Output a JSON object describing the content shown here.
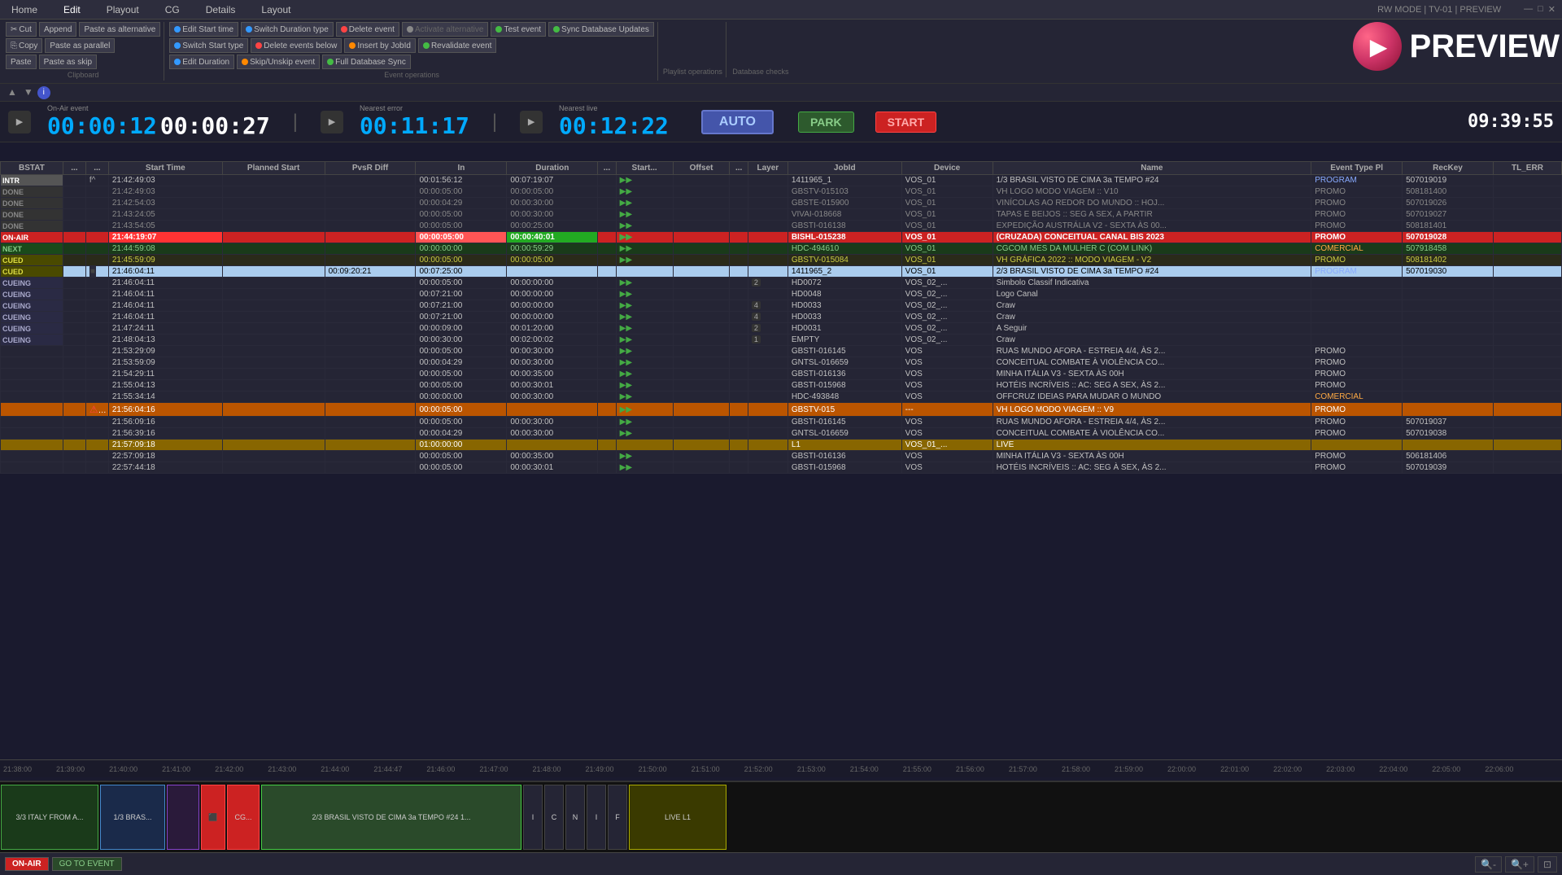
{
  "app": {
    "mode": "RW MODE | TV-01 | PREVIEW",
    "title": "PREVIEW"
  },
  "menu": {
    "items": [
      "Home",
      "Edit",
      "Playout",
      "CG",
      "Details",
      "Layout"
    ],
    "active": "Edit"
  },
  "clipboard": {
    "label": "Clipboard",
    "cut": "Cut",
    "append": "Append",
    "paste_alt": "Paste as alternative",
    "copy": "Copy",
    "paste_parallel": "Paste as parallel",
    "paste": "Paste",
    "paste_skip": "Paste as skip"
  },
  "event_ops": {
    "label": "Event operations",
    "edit_start": "Edit Start time",
    "switch_duration": "Switch Duration type",
    "switch_start": "Switch Start type",
    "delete_event": "Delete event",
    "activate_alt": "Activate alternative",
    "test_event": "Test event",
    "sync_db": "Sync Database Updates",
    "edit_duration": "Edit Duration",
    "delete_below": "Delete events below",
    "insert_jobid": "Insert by JobId",
    "revalidate": "Revalidate event",
    "skip_unskip": "Skip/Unskip event",
    "full_sync": "Full Database Sync"
  },
  "timecodes": {
    "onair_label": "On-Air event",
    "onair_elapsed": "00:00:12",
    "onair_remaining": "00:00:27",
    "error_label": "Nearest error",
    "error_value": "00:11:17",
    "live_label": "Nearest live",
    "live_value": "00:12:22",
    "auto": "AUTO",
    "park": "PARK",
    "start": "START",
    "clock": "09:39:55"
  },
  "table": {
    "columns": [
      "BSTAT",
      "...",
      "...",
      "Start Time",
      "Planned Start",
      "PvsR Diff",
      "In",
      "Duration",
      "...",
      "Start...",
      "Offset",
      "...",
      "Layer",
      "JobId",
      "Device",
      "Name",
      "Event Type Pl",
      "RecKey",
      "TL_ERR"
    ],
    "rows": [
      {
        "bstat": "INTR",
        "bstat_class": "intr",
        "row_class": "intr",
        "f": "f^",
        "start": "21:42:49:03",
        "planned": "",
        "pvsr": "",
        "in": "00:01:56:12",
        "duration": "00:07:19:07",
        "start2": "▶▶",
        "offset": "",
        "layer": "",
        "jobid": "1411965_1",
        "device": "VOS_01",
        "name": "1/3 BRASIL VISTO DE CIMA 3a TEMPO #24",
        "evtype": "PROGRAM",
        "reckey": "507019019",
        "tlerr": ""
      },
      {
        "bstat": "DONE",
        "bstat_class": "done",
        "row_class": "done",
        "f": "",
        "start": "21:42:49:03",
        "planned": "",
        "pvsr": "",
        "in": "00:00:05:00",
        "duration": "00:00:05:00",
        "start2": "▶▶",
        "offset": "",
        "layer": "",
        "jobid": "GBSTV-015103",
        "device": "VOS_01",
        "name": "VH LOGO MODO VIAGEM :: V10",
        "evtype": "PROMO",
        "reckey": "508181400",
        "tlerr": ""
      },
      {
        "bstat": "DONE",
        "bstat_class": "done",
        "row_class": "done",
        "f": "",
        "start": "21:42:54:03",
        "planned": "",
        "pvsr": "",
        "in": "00:00:04:29",
        "duration": "00:00:30:00",
        "start2": "▶▶",
        "offset": "",
        "layer": "",
        "jobid": "GBSTE-015900",
        "device": "VOS_01",
        "name": "VINÍCOLAS AO REDOR DO MUNDO :: HOJ...",
        "evtype": "PROMO",
        "reckey": "507019026",
        "tlerr": ""
      },
      {
        "bstat": "DONE",
        "bstat_class": "done",
        "row_class": "done",
        "f": "",
        "start": "21:43:24:05",
        "planned": "",
        "pvsr": "",
        "in": "00:00:05:00",
        "duration": "00:00:30:00",
        "start2": "▶▶",
        "offset": "",
        "layer": "",
        "jobid": "VIVAI-018668",
        "device": "VOS_01",
        "name": "TAPAS E BEIJOS :: SEG A SEX, A PARTIR",
        "evtype": "PROMO",
        "reckey": "507019027",
        "tlerr": ""
      },
      {
        "bstat": "DONE",
        "bstat_class": "done",
        "row_class": "done",
        "f": "",
        "start": "21:43:54:05",
        "planned": "",
        "pvsr": "",
        "in": "00:00:05:00",
        "duration": "00:00:25:00",
        "start2": "▶▶",
        "offset": "",
        "layer": "",
        "jobid": "GBSTI-016138",
        "device": "VOS_01",
        "name": "EXPEDIÇÃO AUSTRÁLIA V2 - SEXTA ÀS 00...",
        "evtype": "PROMO",
        "reckey": "508181401",
        "tlerr": ""
      },
      {
        "bstat": "ON-AIR",
        "bstat_class": "onair",
        "row_class": "onair",
        "f": "",
        "start": "21:44:19:07",
        "planned": "",
        "pvsr": "",
        "in": "00:00:05:00",
        "duration": "00:00:40:01",
        "start2": "▶▶",
        "offset": "",
        "layer": "",
        "jobid": "BISHL-015238",
        "device": "VOS_01",
        "name": "(CRUZADA) CONCEITUAL CANAL BIS 2023",
        "evtype": "PROMO",
        "reckey": "507019028",
        "tlerr": ""
      },
      {
        "bstat": "NEXT",
        "bstat_class": "next",
        "row_class": "next",
        "f": "",
        "start": "21:44:59:08",
        "planned": "",
        "pvsr": "",
        "in": "00:00:00:00",
        "duration": "00:00:59:29",
        "start2": "▶▶",
        "offset": "",
        "layer": "",
        "jobid": "HDC-494610",
        "device": "VOS_01",
        "name": "CGCOM MES DA MULHER C (COM LINK)",
        "evtype": "COMERCIAL",
        "reckey": "507918458",
        "tlerr": ""
      },
      {
        "bstat": "CUED",
        "bstat_class": "cued",
        "row_class": "cued",
        "f": "",
        "start": "21:45:59:09",
        "planned": "",
        "pvsr": "",
        "in": "00:00:05:00",
        "duration": "00:00:05:00",
        "start2": "▶▶",
        "offset": "",
        "layer": "",
        "jobid": "GBSTV-015084",
        "device": "VOS_01",
        "name": "VH GRÁFICA 2022 :: MODO VIAGEM - V2",
        "evtype": "PROMO",
        "reckey": "508181402",
        "tlerr": ""
      },
      {
        "bstat": "CUED",
        "bstat_class": "cued",
        "row_class": "light",
        "f": "■",
        "start": "21:46:04:11",
        "planned": "",
        "pvsr": "00:09:20:21",
        "in": "00:07:25:00",
        "duration": "",
        "start2": "",
        "offset": "",
        "layer": "",
        "jobid": "1411965_2",
        "device": "VOS_01",
        "name": "2/3 BRASIL VISTO DE CIMA 3a TEMPO #24",
        "evtype": "PROGRAM",
        "reckey": "507019030",
        "tlerr": ""
      },
      {
        "bstat": "CUEING",
        "bstat_class": "cueing",
        "row_class": "default",
        "f": "",
        "start": "21:46:04:11",
        "planned": "",
        "pvsr": "",
        "in": "00:00:05:00",
        "duration": "00:00:00:00",
        "start2": "▶▶",
        "offset": "",
        "layer": "2",
        "jobid": "HD0072",
        "device": "VOS_02_...",
        "name": "Simbolo Classif Indicativa",
        "evtype": "",
        "reckey": "",
        "tlerr": ""
      },
      {
        "bstat": "CUEING",
        "bstat_class": "cueing",
        "row_class": "default",
        "f": "",
        "start": "21:46:04:11",
        "planned": "",
        "pvsr": "",
        "in": "00:07:21:00",
        "duration": "00:00:00:00",
        "start2": "▶▶",
        "offset": "",
        "layer": "",
        "jobid": "HD0048",
        "device": "VOS_02_...",
        "name": "Logo Canal",
        "evtype": "",
        "reckey": "",
        "tlerr": ""
      },
      {
        "bstat": "CUEING",
        "bstat_class": "cueing",
        "row_class": "default",
        "f": "",
        "start": "21:46:04:11",
        "planned": "",
        "pvsr": "",
        "in": "00:07:21:00",
        "duration": "00:00:00:00",
        "start2": "▶▶",
        "offset": "",
        "layer": "4",
        "jobid": "HD0033",
        "device": "VOS_02_...",
        "name": "Craw",
        "evtype": "",
        "reckey": "",
        "tlerr": ""
      },
      {
        "bstat": "CUEING",
        "bstat_class": "cueing",
        "row_class": "default",
        "f": "",
        "start": "21:46:04:11",
        "planned": "",
        "pvsr": "",
        "in": "00:07:21:00",
        "duration": "00:00:00:00",
        "start2": "▶▶",
        "offset": "",
        "layer": "4",
        "jobid": "HD0033",
        "device": "VOS_02_...",
        "name": "Craw",
        "evtype": "",
        "reckey": "",
        "tlerr": ""
      },
      {
        "bstat": "CUEING",
        "bstat_class": "cueing",
        "row_class": "default",
        "f": "",
        "start": "21:47:24:11",
        "planned": "",
        "pvsr": "",
        "in": "00:00:09:00",
        "duration": "00:01:20:00",
        "start2": "▶▶",
        "offset": "",
        "layer": "2",
        "jobid": "HD0031",
        "device": "VOS_02_...",
        "name": "A Seguir",
        "evtype": "",
        "reckey": "",
        "tlerr": ""
      },
      {
        "bstat": "CUEING",
        "bstat_class": "cueing",
        "row_class": "default",
        "f": "",
        "start": "21:48:04:13",
        "planned": "",
        "pvsr": "",
        "in": "00:00:30:00",
        "duration": "00:02:00:02",
        "start2": "▶▶",
        "offset": "",
        "layer": "1",
        "jobid": "EMPTY",
        "device": "VOS_02_...",
        "name": "Craw",
        "evtype": "",
        "reckey": "",
        "tlerr": ""
      },
      {
        "bstat": "",
        "bstat_class": "",
        "row_class": "default",
        "f": "",
        "start": "21:53:29:09",
        "planned": "",
        "pvsr": "",
        "in": "00:00:05:00",
        "duration": "00:00:30:00",
        "start2": "▶▶",
        "offset": "",
        "layer": "",
        "jobid": "GBSTI-016145",
        "device": "VOS",
        "name": "RUAS MUNDO AFORA - ESTREIA 4/4, ÀS 2...",
        "evtype": "PROMO",
        "reckey": "",
        "tlerr": ""
      },
      {
        "bstat": "",
        "bstat_class": "",
        "row_class": "default",
        "f": "",
        "start": "21:53:59:09",
        "planned": "",
        "pvsr": "",
        "in": "00:00:04:29",
        "duration": "00:00:30:00",
        "start2": "▶▶",
        "offset": "",
        "layer": "",
        "jobid": "GNTSL-016659",
        "device": "VOS",
        "name": "CONCEITUAL COMBATE À VIOLÊNCIA CO...",
        "evtype": "PROMO",
        "reckey": "",
        "tlerr": ""
      },
      {
        "bstat": "",
        "bstat_class": "",
        "row_class": "default",
        "f": "",
        "start": "21:54:29:11",
        "planned": "",
        "pvsr": "",
        "in": "00:00:05:00",
        "duration": "00:00:35:00",
        "start2": "▶▶",
        "offset": "",
        "layer": "",
        "jobid": "GBSTI-016136",
        "device": "VOS",
        "name": "MINHA ITÁLIA V3 - SEXTA ÀS 00H",
        "evtype": "PROMO",
        "reckey": "",
        "tlerr": ""
      },
      {
        "bstat": "",
        "bstat_class": "",
        "row_class": "default",
        "f": "",
        "start": "21:55:04:13",
        "planned": "",
        "pvsr": "",
        "in": "00:00:05:00",
        "duration": "00:00:30:01",
        "start2": "▶▶",
        "offset": "",
        "layer": "",
        "jobid": "GBSTI-015968",
        "device": "VOS",
        "name": "HOTÉIS INCRÍVEIS :: AC: SEG A SEX, ÀS 2...",
        "evtype": "PROMO",
        "reckey": "",
        "tlerr": ""
      },
      {
        "bstat": "",
        "bstat_class": "",
        "row_class": "default",
        "f": "",
        "start": "21:55:34:14",
        "planned": "",
        "pvsr": "",
        "in": "00:00:00:00",
        "duration": "00:00:30:00",
        "start2": "▶▶",
        "offset": "",
        "layer": "",
        "jobid": "HDC-493848",
        "device": "VOS",
        "name": "OFFCRUZ IDEIAS PARA MUDAR O MUNDO",
        "evtype": "COMERCIAL",
        "reckey": "",
        "tlerr": ""
      },
      {
        "bstat": "",
        "bstat_class": "orange",
        "row_class": "orange",
        "f": "⚠ ●",
        "start": "21:56:04:16",
        "planned": "",
        "pvsr": "",
        "in": "00:00:05:00",
        "duration": "",
        "start2": "▶▶",
        "offset": "",
        "layer": "",
        "jobid": "GBSTV-015",
        "device": "---",
        "name": "VH LOGO MODO VIAGEM :: V9",
        "evtype": "PROMO",
        "reckey": "",
        "tlerr": ""
      },
      {
        "bstat": "",
        "bstat_class": "",
        "row_class": "default",
        "f": "",
        "start": "21:56:09:16",
        "planned": "",
        "pvsr": "",
        "in": "00:00:05:00",
        "duration": "00:00:30:00",
        "start2": "▶▶",
        "offset": "",
        "layer": "",
        "jobid": "GBSTI-016145",
        "device": "VOS",
        "name": "RUAS MUNDO AFORA - ESTREIA 4/4, ÀS 2...",
        "evtype": "PROMO",
        "reckey": "507019037",
        "tlerr": ""
      },
      {
        "bstat": "",
        "bstat_class": "",
        "row_class": "default",
        "f": "",
        "start": "21:56:39:16",
        "planned": "",
        "pvsr": "",
        "in": "00:00:04:29",
        "duration": "00:00:30:00",
        "start2": "▶▶",
        "offset": "",
        "layer": "",
        "jobid": "GNTSL-016659",
        "device": "VOS",
        "name": "CONCEITUAL COMBATE À VIOLÊNCIA CO...",
        "evtype": "PROMO",
        "reckey": "507019038",
        "tlerr": ""
      },
      {
        "bstat": "",
        "bstat_class": "gold",
        "row_class": "gold",
        "f": "",
        "start": "21:57:09:18",
        "planned": "",
        "pvsr": "",
        "in": "01:00:00:00",
        "duration": "",
        "start2": "",
        "offset": "",
        "layer": "",
        "jobid": "L1",
        "device": "VOS_01_...",
        "name": "LIVE",
        "evtype": "",
        "reckey": "",
        "tlerr": ""
      },
      {
        "bstat": "",
        "bstat_class": "",
        "row_class": "default",
        "f": "",
        "start": "22:57:09:18",
        "planned": "",
        "pvsr": "",
        "in": "00:00:05:00",
        "duration": "00:00:35:00",
        "start2": "▶▶",
        "offset": "",
        "layer": "",
        "jobid": "GBSTI-016136",
        "device": "VOS",
        "name": "MINHA ITÁLIA V3 - SEXTA ÀS 00H",
        "evtype": "PROMO",
        "reckey": "506181406",
        "tlerr": ""
      },
      {
        "bstat": "",
        "bstat_class": "",
        "row_class": "default",
        "f": "",
        "start": "22:57:44:18",
        "planned": "",
        "pvsr": "",
        "in": "00:00:05:00",
        "duration": "00:00:30:01",
        "start2": "▶▶",
        "offset": "",
        "layer": "",
        "jobid": "GBSTI-015968",
        "device": "VOS",
        "name": "HOTÉIS INCRÍVEIS :: AC: SEG À SEX, ÀS 2...",
        "evtype": "PROMO",
        "reckey": "507019039",
        "tlerr": ""
      }
    ]
  },
  "timeline": {
    "times": [
      "21:38:00",
      "21:39:00",
      "21:40:00",
      "21:41:00",
      "21:42:00",
      "21:43:00",
      "21:44:00",
      "21:44:47",
      "21:46:00",
      "21:47:00",
      "21:48:00",
      "21:49:00",
      "21:50:00",
      "21:51:00",
      "21:52:00",
      "21:53:00",
      "21:54:00",
      "21:55:00",
      "21:56:00",
      "21:57:00",
      "21:58:00",
      "21:59:00",
      "22:00:00",
      "22:01:00",
      "22:02:00",
      "22:03:00",
      "22:04:00",
      "22:05:00",
      "22:06:00"
    ]
  },
  "strip": {
    "items": [
      {
        "label": "3/3 ITALY FROM A...",
        "class": "green"
      },
      {
        "label": "1/3 BRAS...",
        "class": "blue"
      },
      {
        "label": "",
        "class": "purple"
      },
      {
        "label": "⬛",
        "class": "red"
      },
      {
        "label": "(C CG...",
        "class": "red"
      },
      {
        "label": "2/3 BRASIL VISTO DE CIMA 3a TEMPO #24 1...",
        "class": "green"
      },
      {
        "label": "I",
        "class": "default"
      },
      {
        "label": "C",
        "class": "default"
      },
      {
        "label": "N",
        "class": "default"
      },
      {
        "label": "I",
        "class": "default"
      },
      {
        "label": "F",
        "class": "default"
      },
      {
        "label": "LIVE L1",
        "class": "gold"
      }
    ]
  },
  "bottom": {
    "on_air": "ON-AIR",
    "go_to_event": "GO TO EVENT",
    "zoom_in": "+",
    "zoom_out": "-",
    "zoom_fit": "⊠"
  }
}
